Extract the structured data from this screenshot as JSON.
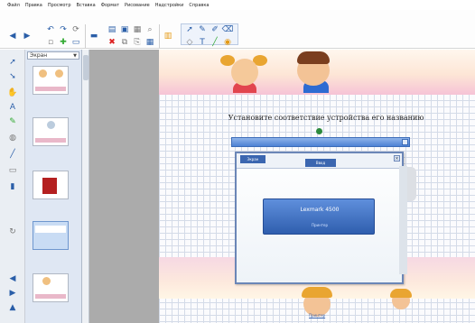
{
  "menu": [
    "Файл",
    "Правка",
    "Просмотр",
    "Вставка",
    "Формат",
    "Рисование",
    "Надстройки",
    "Справка"
  ],
  "toolbar": {
    "buttons": [
      "back-icon",
      "forward-icon",
      "undo-icon",
      "redo-icon",
      "delete-icon",
      "screen-icon",
      "new-page-icon",
      "image-icon",
      "select-icon",
      "pen-icon",
      "eraser-icon",
      "line-icon",
      "shape-icon",
      "text-icon",
      "color-icon",
      "fill-icon"
    ]
  },
  "slide_panel": {
    "dropdown_label": "Экран"
  },
  "slide": {
    "heading": "Установите соответствие устройства его названию",
    "dialog": {
      "tab1_label": "Экран",
      "tab2_label": "Ввод",
      "close_label": "×",
      "card_title": "Lexmark 4500",
      "card_button": "Принтер"
    },
    "bottom_link": "Принтер"
  },
  "colors": {
    "accent": "#3b66b0",
    "workspace_bg": "#ababab",
    "panel_bg": "#dfe7f3"
  }
}
